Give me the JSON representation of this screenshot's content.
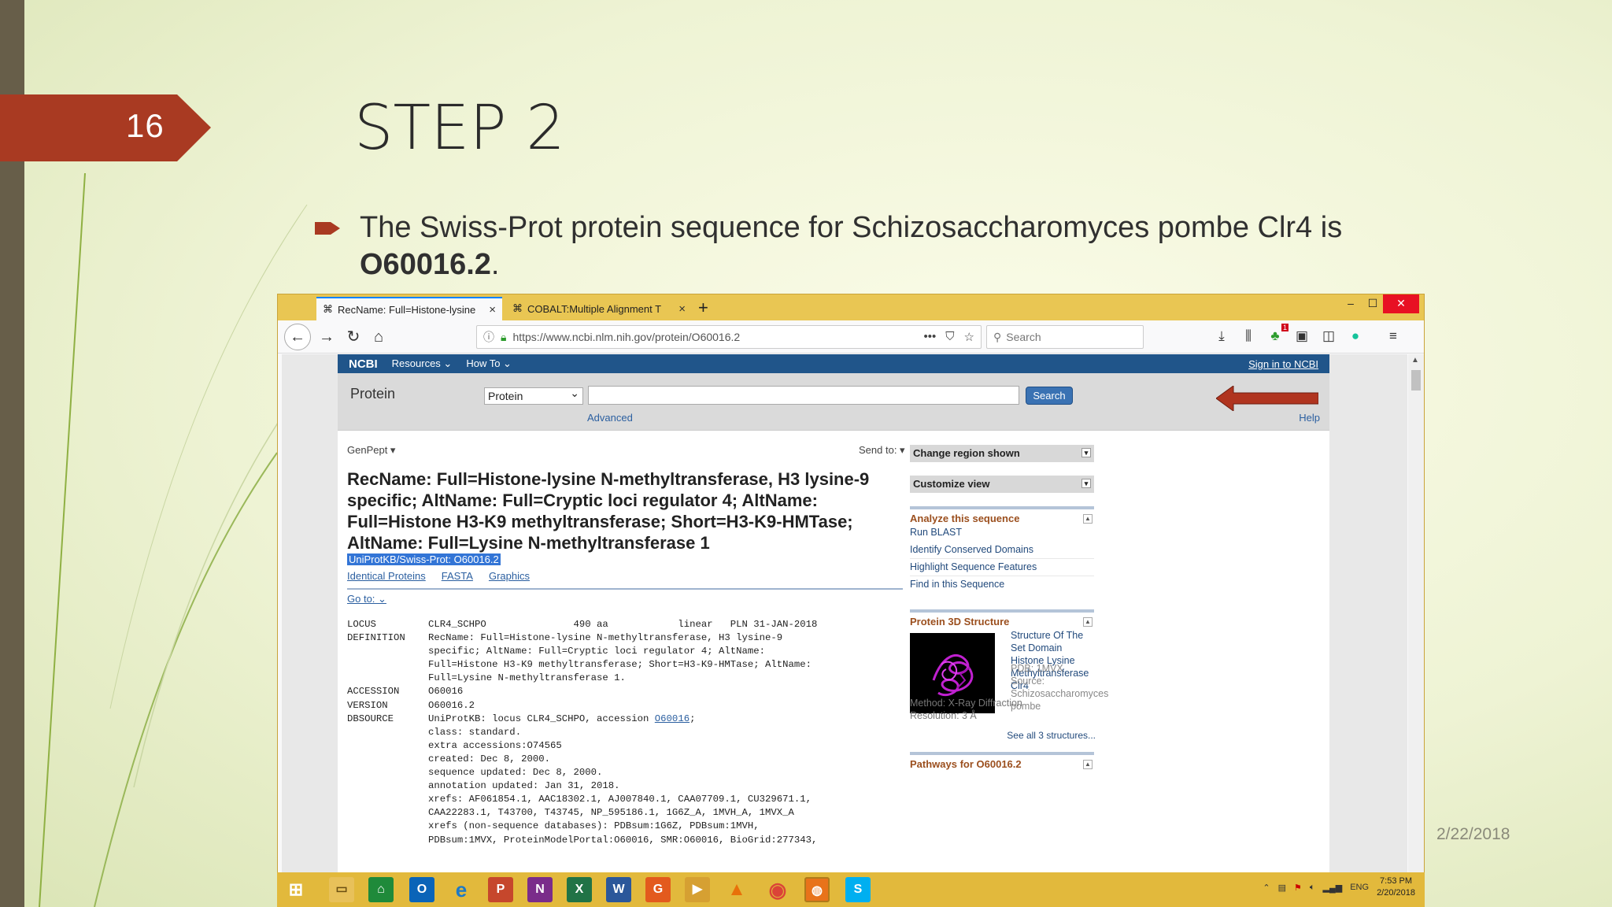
{
  "slide": {
    "number": "16",
    "title": "STEP 2",
    "bullet_prefix": "The Swiss-Prot protein sequence for Schizosaccharomyces pombe Clr4 is ",
    "bullet_bold": "O60016.2",
    "bullet_suffix": ".",
    "date": "2/22/2018"
  },
  "browser": {
    "tabs": [
      {
        "label": "RecName: Full=Histone-lysine",
        "close": "×"
      },
      {
        "label": "COBALT:Multiple Alignment T",
        "close": "×"
      }
    ],
    "new_tab": "+",
    "url": "https://www.ncbi.nlm.nih.gov/protein/O60016.2",
    "url_actions": "•••",
    "search_placeholder": "Search",
    "window_controls": {
      "minimize": "–",
      "maximize": "☐",
      "close": "✕"
    },
    "notification_badge": "1"
  },
  "ncbi": {
    "logo": "NCBI",
    "resources": "Resources ⌄",
    "how_to": "How To ⌄",
    "sign_in": "Sign in to NCBI",
    "db_label": "Protein",
    "db_select": "Protein",
    "search_button": "Search",
    "advanced": "Advanced",
    "help": "Help"
  },
  "record": {
    "genpept": "GenPept ▾",
    "send_to": "Send to: ▾",
    "title": "RecName: Full=Histone-lysine N-methyltransferase, H3 lysine-9 specific; AltName: Full=Cryptic loci regulator 4; AltName: Full=Histone H3-K9 methyltransferase; Short=H3-K9-HMTase; AltName: Full=Lysine N-methyltransferase 1",
    "accession_line": "UniProtKB/Swiss-Prot: O60016.2",
    "links": [
      "Identical Proteins",
      "FASTA",
      "Graphics"
    ],
    "goto": "Go to: ⌄",
    "genbank": [
      {
        "key": "LOCUS",
        "value": "CLR4_SCHPO               490 aa            linear   PLN 31-JAN-2018"
      },
      {
        "key": "DEFINITION",
        "value": "RecName: Full=Histone-lysine N-methyltransferase, H3 lysine-9"
      },
      {
        "key": "",
        "value": "specific; AltName: Full=Cryptic loci regulator 4; AltName:"
      },
      {
        "key": "",
        "value": "Full=Histone H3-K9 methyltransferase; Short=H3-K9-HMTase; AltName:"
      },
      {
        "key": "",
        "value": "Full=Lysine N-methyltransferase 1."
      },
      {
        "key": "ACCESSION",
        "value": "O60016"
      },
      {
        "key": "VERSION",
        "value": "O60016.2"
      },
      {
        "key": "DBSOURCE",
        "value": "UniProtKB: locus CLR4_SCHPO, accession ",
        "link": "O60016",
        "tail": ";"
      },
      {
        "key": "",
        "value": "class: standard."
      },
      {
        "key": "",
        "value": "extra accessions:O74565"
      },
      {
        "key": "",
        "value": "created: Dec 8, 2000."
      },
      {
        "key": "",
        "value": "sequence updated: Dec 8, 2000."
      },
      {
        "key": "",
        "value": "annotation updated: Jan 31, 2018."
      },
      {
        "key": "",
        "value": "xrefs: AF061854.1, AAC18302.1, AJ007840.1, CAA07709.1, CU329671.1,"
      },
      {
        "key": "",
        "value": "CAA22283.1, T43700, T43745, NP_595186.1, 1G6Z_A, 1MVH_A, 1MVX_A"
      },
      {
        "key": "",
        "value": "xrefs (non-sequence databases): PDBsum:1G6Z, PDBsum:1MVH,"
      },
      {
        "key": "",
        "value": "PDBsum:1MVX, ProteinModelPortal:O60016, SMR:O60016, BioGrid:277343,"
      }
    ]
  },
  "sidebar": {
    "change_region": "Change region shown",
    "customize_view": "Customize view",
    "analyze_head": "Analyze this sequence",
    "analyze_links": [
      "Run BLAST",
      "Identify Conserved Domains",
      "Highlight Sequence Features",
      "Find in this Sequence"
    ],
    "structure_head": "Protein 3D Structure",
    "structure_title": "Structure Of The Set Domain Histone Lysine Methyltransferase Clr4",
    "structure_pdb": "PDB: 1MVX",
    "structure_source": "Source: Schizosaccharomyces pombe",
    "structure_method": "Method: X-Ray Diffraction",
    "structure_resolution": "Resolution: 3 Å",
    "see_all": "See all 3 structures...",
    "pathways_head": "Pathways for O60016.2"
  },
  "taskbar": {
    "language": "ENG",
    "time": "7:53 PM",
    "date": "2/20/2018"
  },
  "colors": {
    "slide_number_bg": "#a93a22",
    "ncbi_blue": "#20558a",
    "highlight": "#3375d6",
    "taskbar": "#e2b93c"
  }
}
